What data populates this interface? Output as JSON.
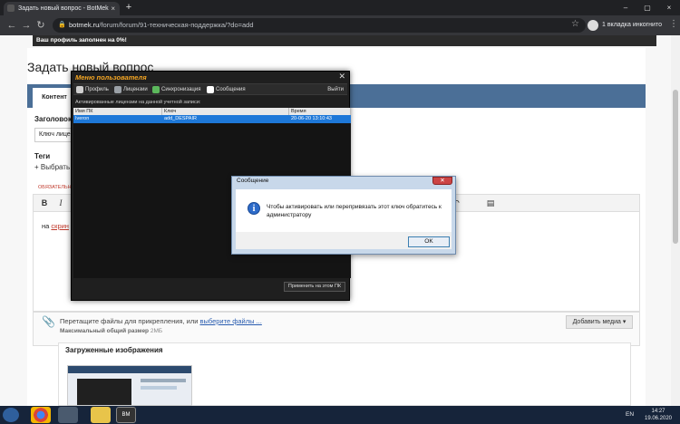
{
  "browser": {
    "tab_title": "Задать новый вопрос - BotMek",
    "tab_close": "×",
    "new_tab": "+",
    "window_controls": [
      "–",
      "▢",
      "×"
    ],
    "url_host": "botmek.ru",
    "url_path": "/forum/forum/91-техническая-поддержка/?do=add",
    "incognito_label": "1 вкладка инкогнито"
  },
  "page": {
    "profile_notice": "Ваш профиль заполнен на 0%!",
    "title": "Задать новый вопрос",
    "editor_tab": "Контент",
    "title_label": "Заголовок",
    "title_value": "Ключ лице",
    "tags_label": "Теги",
    "tags_add": "+ Выбрать",
    "required_note": "ОБЯЗАТЕЛЬНО",
    "toolbar": {
      "bold": "B",
      "italic": "I"
    },
    "editor_prefix": "на ",
    "editor_underlined": "скрин",
    "attach_text": "Перетащите файлы для прикрепления, или ",
    "attach_link": "выберите файлы ...",
    "attach_max_label": "Максимальный общий размер ",
    "attach_max_value": "2МБ",
    "media_button": "Добавить медиа ▾",
    "uploaded_title": "Загруженные изображения"
  },
  "app_dialog": {
    "title": "Меню пользователя",
    "close": "✕",
    "menu": [
      "Профиль",
      "Лицензии",
      "Синхронизация",
      "Сообщения"
    ],
    "menu_colors": [
      "#cfcfcf",
      "#9aa0a6",
      "#5cb85c",
      "#ffffff"
    ],
    "exit": "Выйти",
    "section_label": "Активированные лицензии на данной учетной записи:",
    "columns": [
      "Имя ПК",
      "Ключ",
      "Время"
    ],
    "rows": [
      [
        "Iveron",
        "add_DESPAIR",
        "20-06-20 13:10:43"
      ]
    ],
    "apply_button": "Применить на этом ПК"
  },
  "message_box": {
    "title": "Сообщение",
    "close": "✕",
    "icon": "i",
    "text": "Чтобы активировать или перепривязать этот ключ обратитесь к администратору",
    "ok": "OK"
  },
  "taskbar": {
    "lang": "EN",
    "time": "14:27",
    "date": "19.06.2020"
  },
  "colors": {
    "app_title": "#f5a623",
    "selected_row": "#1e78d8",
    "editor_header": "#4b6f97"
  }
}
